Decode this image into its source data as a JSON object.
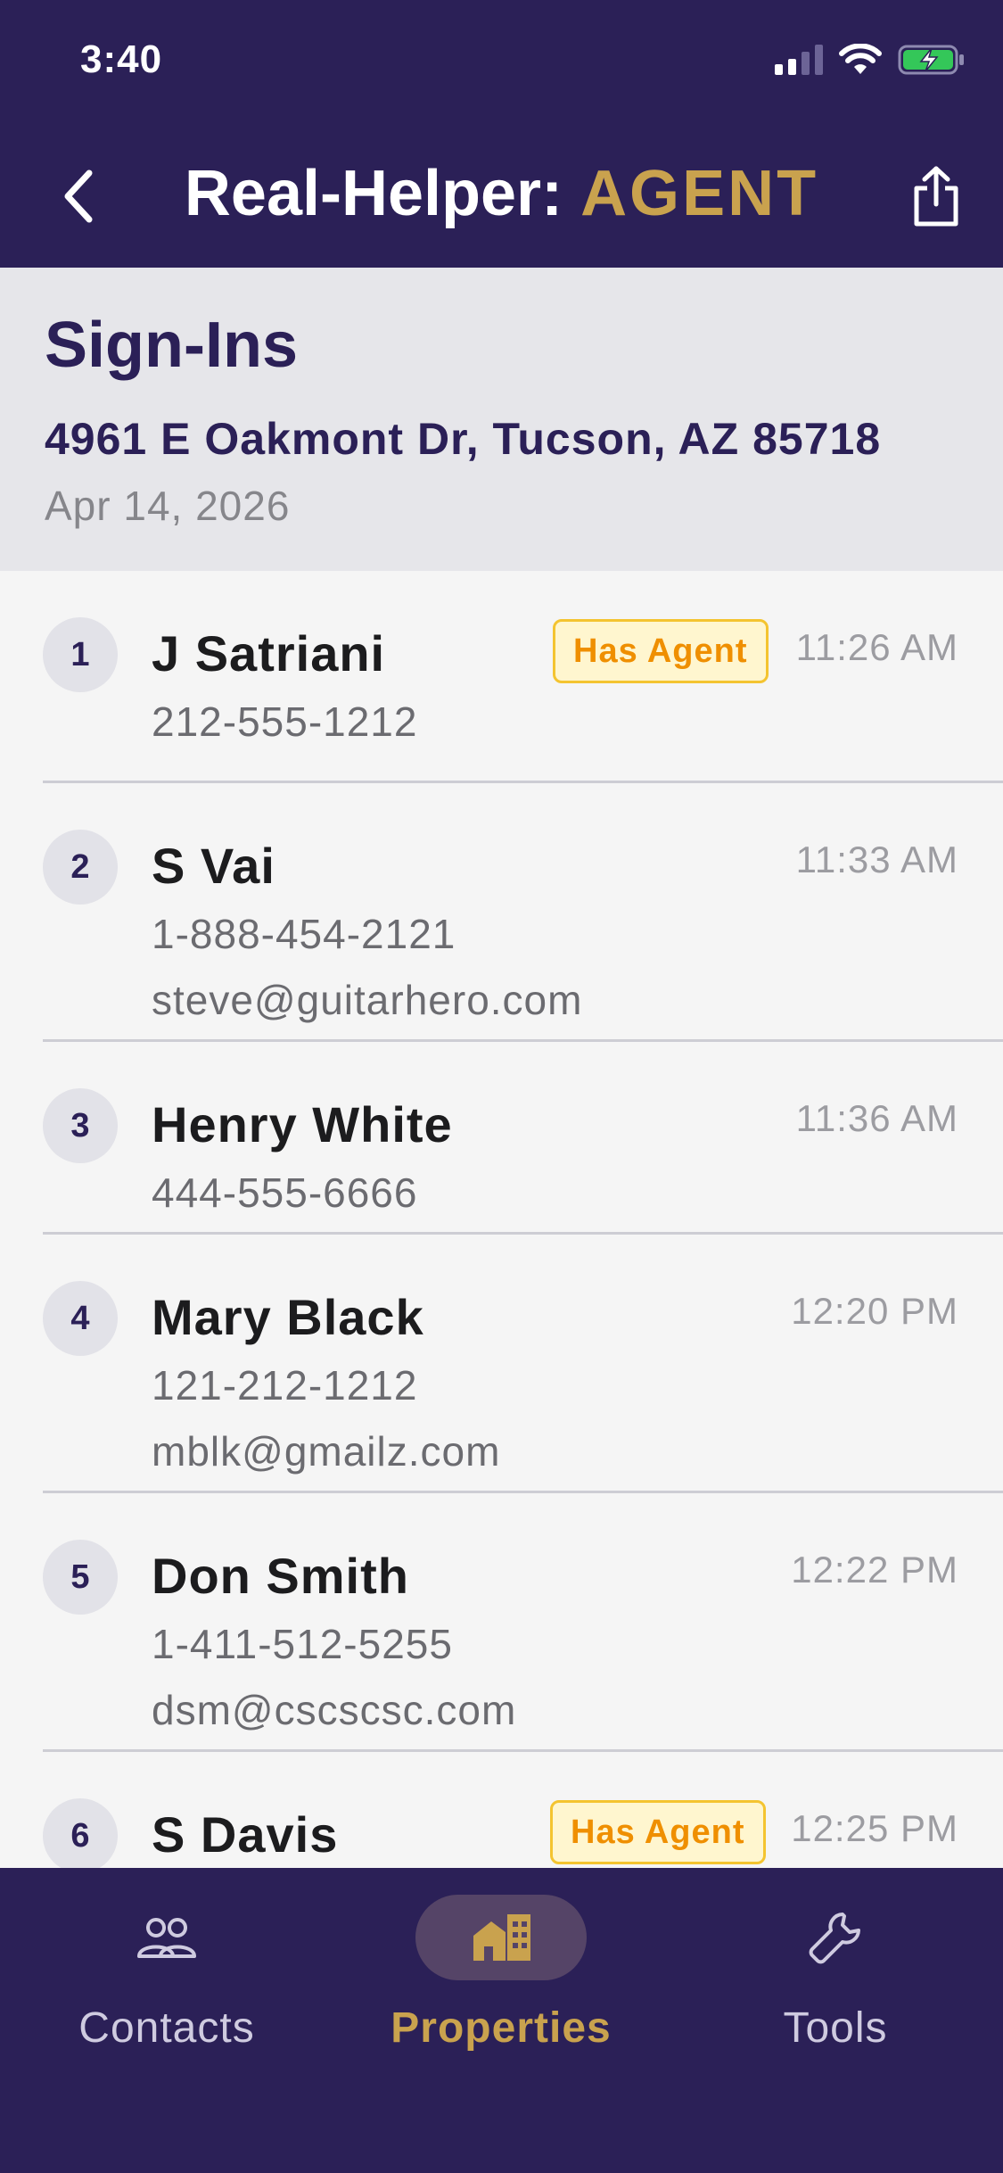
{
  "status_bar": {
    "time": "3:40"
  },
  "nav": {
    "title": "Real-Helper: ",
    "title_accent": "AGENT"
  },
  "header": {
    "title": "Sign-Ins",
    "address": "4961 E Oakmont Dr, Tucson, AZ 85718",
    "date": "Apr 14, 2026"
  },
  "signins": [
    {
      "index": "1",
      "name": "J Satriani",
      "phone": "212-555-1212",
      "email": "",
      "time": "11:26 AM",
      "badge": "Has Agent"
    },
    {
      "index": "2",
      "name": "S Vai",
      "phone": "1-888-454-2121",
      "email": "steve@guitarhero.com",
      "time": "11:33 AM",
      "badge": ""
    },
    {
      "index": "3",
      "name": "Henry White",
      "phone": "444-555-6666",
      "email": "",
      "time": "11:36 AM",
      "badge": ""
    },
    {
      "index": "4",
      "name": "Mary Black",
      "phone": "121-212-1212",
      "email": "mblk@gmailz.com",
      "time": "12:20 PM",
      "badge": ""
    },
    {
      "index": "5",
      "name": "Don Smith",
      "phone": "1-411-512-5255",
      "email": "dsm@cscscsc.com",
      "time": "12:22 PM",
      "badge": ""
    },
    {
      "index": "6",
      "name": "S Davis",
      "phone": "",
      "email": "",
      "time": "12:25 PM",
      "badge": "Has Agent"
    }
  ],
  "tabs": [
    {
      "label": "Contacts",
      "icon": "people-icon",
      "active": false
    },
    {
      "label": "Properties",
      "icon": "building-icon",
      "active": true
    },
    {
      "label": "Tools",
      "icon": "wrench-icon",
      "active": false
    }
  ],
  "colors": {
    "primary": "#2b2057",
    "accent": "#c9a24e",
    "badge_text": "#ef8f00",
    "badge_border": "#f4c430",
    "battery": "#34c759"
  }
}
